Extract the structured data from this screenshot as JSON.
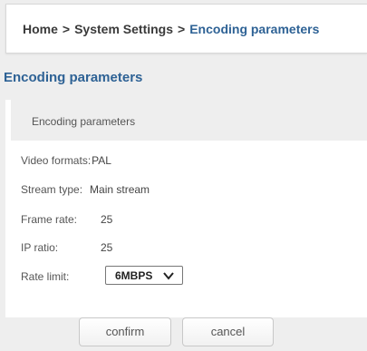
{
  "breadcrumb": {
    "home": "Home",
    "separator": ">",
    "section": "System Settings",
    "current": "Encoding parameters"
  },
  "page_title": "Encoding parameters",
  "panel": {
    "header": "Encoding parameters",
    "fields": {
      "video_formats": {
        "label": "Video formats:",
        "value": "PAL"
      },
      "stream_type": {
        "label": "Stream type:",
        "value": "Main stream"
      },
      "frame_rate": {
        "label": "Frame rate:",
        "value": "25"
      },
      "ip_ratio": {
        "label": "IP ratio:",
        "value": "25"
      },
      "rate_limit": {
        "label": "Rate limit:",
        "selected": "6MBPS"
      }
    }
  },
  "buttons": {
    "confirm": "confirm",
    "cancel": "cancel"
  },
  "colors": {
    "accent": "#2e6295",
    "background": "#eeeeee"
  }
}
